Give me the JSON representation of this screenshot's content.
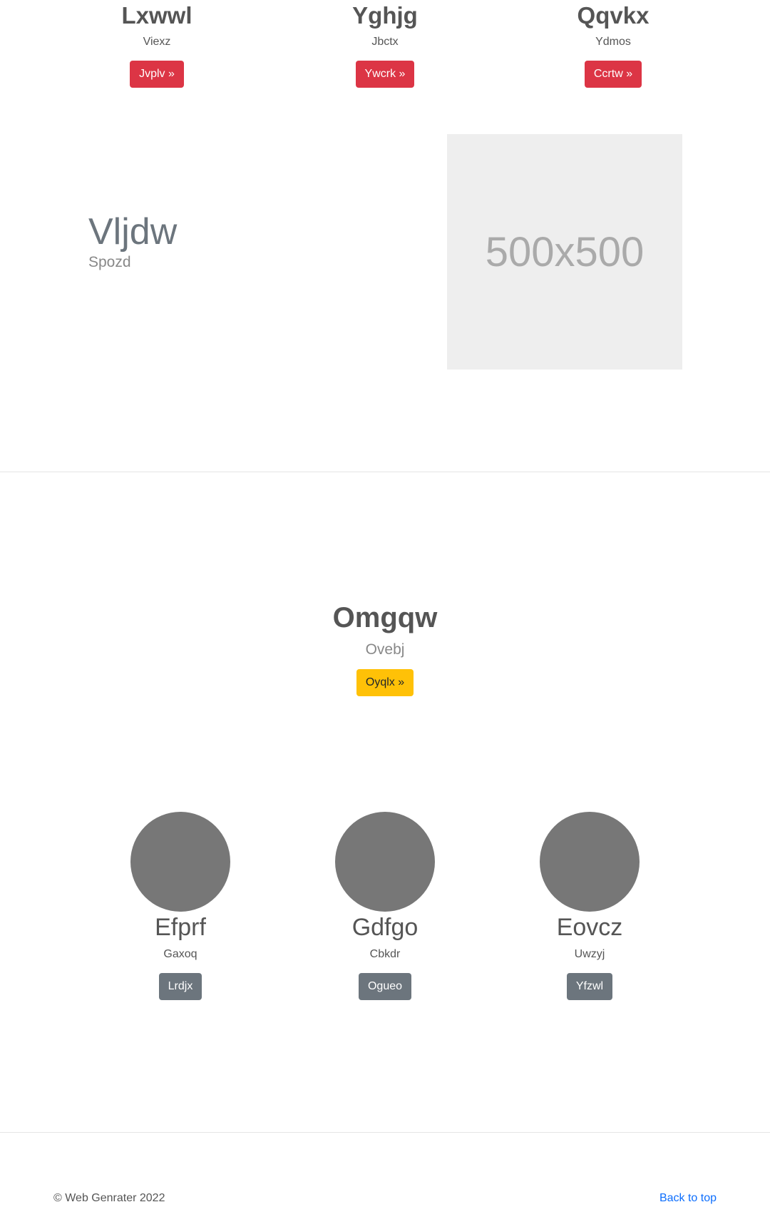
{
  "top_columns": [
    {
      "title": "Lxwwl",
      "subtitle": "Viexz",
      "button": "Jvplv »"
    },
    {
      "title": "Yghjg",
      "subtitle": "Jbctx",
      "button": "Ywcrk »"
    },
    {
      "title": "Qqvkx",
      "subtitle": "Ydmos",
      "button": "Ccrtw »"
    }
  ],
  "feature": {
    "heading": "Vljdw",
    "subheading": "Spozd",
    "image_placeholder": "500x500"
  },
  "center": {
    "heading": "Omgqw",
    "subheading": "Ovebj",
    "button": "Oyqlx »"
  },
  "profiles": [
    {
      "name": "Efprf",
      "subtitle": "Gaxoq",
      "button": "Lrdjx"
    },
    {
      "name": "Gdfgo",
      "subtitle": "Cbkdr",
      "button": "Ogueo"
    },
    {
      "name": "Eovcz",
      "subtitle": "Uwzyj",
      "button": "Yfzwl"
    }
  ],
  "footer": {
    "copyright": "© Web Genrater 2022",
    "back_to_top": "Back to top"
  },
  "colors": {
    "danger": "#dc3545",
    "warning": "#ffc107",
    "secondary": "#6c757d",
    "link": "#0d6efd",
    "placeholder_bg": "#eeeeee",
    "circle": "#777777"
  }
}
